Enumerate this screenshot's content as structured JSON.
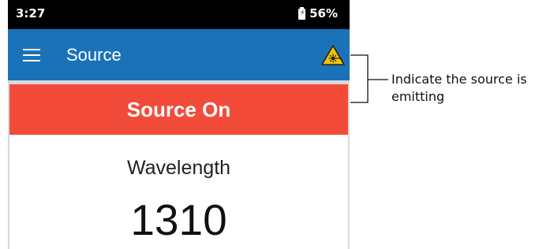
{
  "status_bar": {
    "time": "3:27",
    "battery_percent": "56%",
    "battery_icon": "battery-charging-icon"
  },
  "app_bar": {
    "menu_icon": "menu-icon",
    "title": "Source",
    "warning_icon": "laser-warning-icon",
    "background_color": "#1a73b8"
  },
  "source_panel": {
    "status_label": "Source On",
    "status_color": "#f24b3a",
    "wavelength_label": "Wavelength",
    "wavelength_value": "1310"
  },
  "callout": {
    "text": "Indicate the source is emitting"
  }
}
